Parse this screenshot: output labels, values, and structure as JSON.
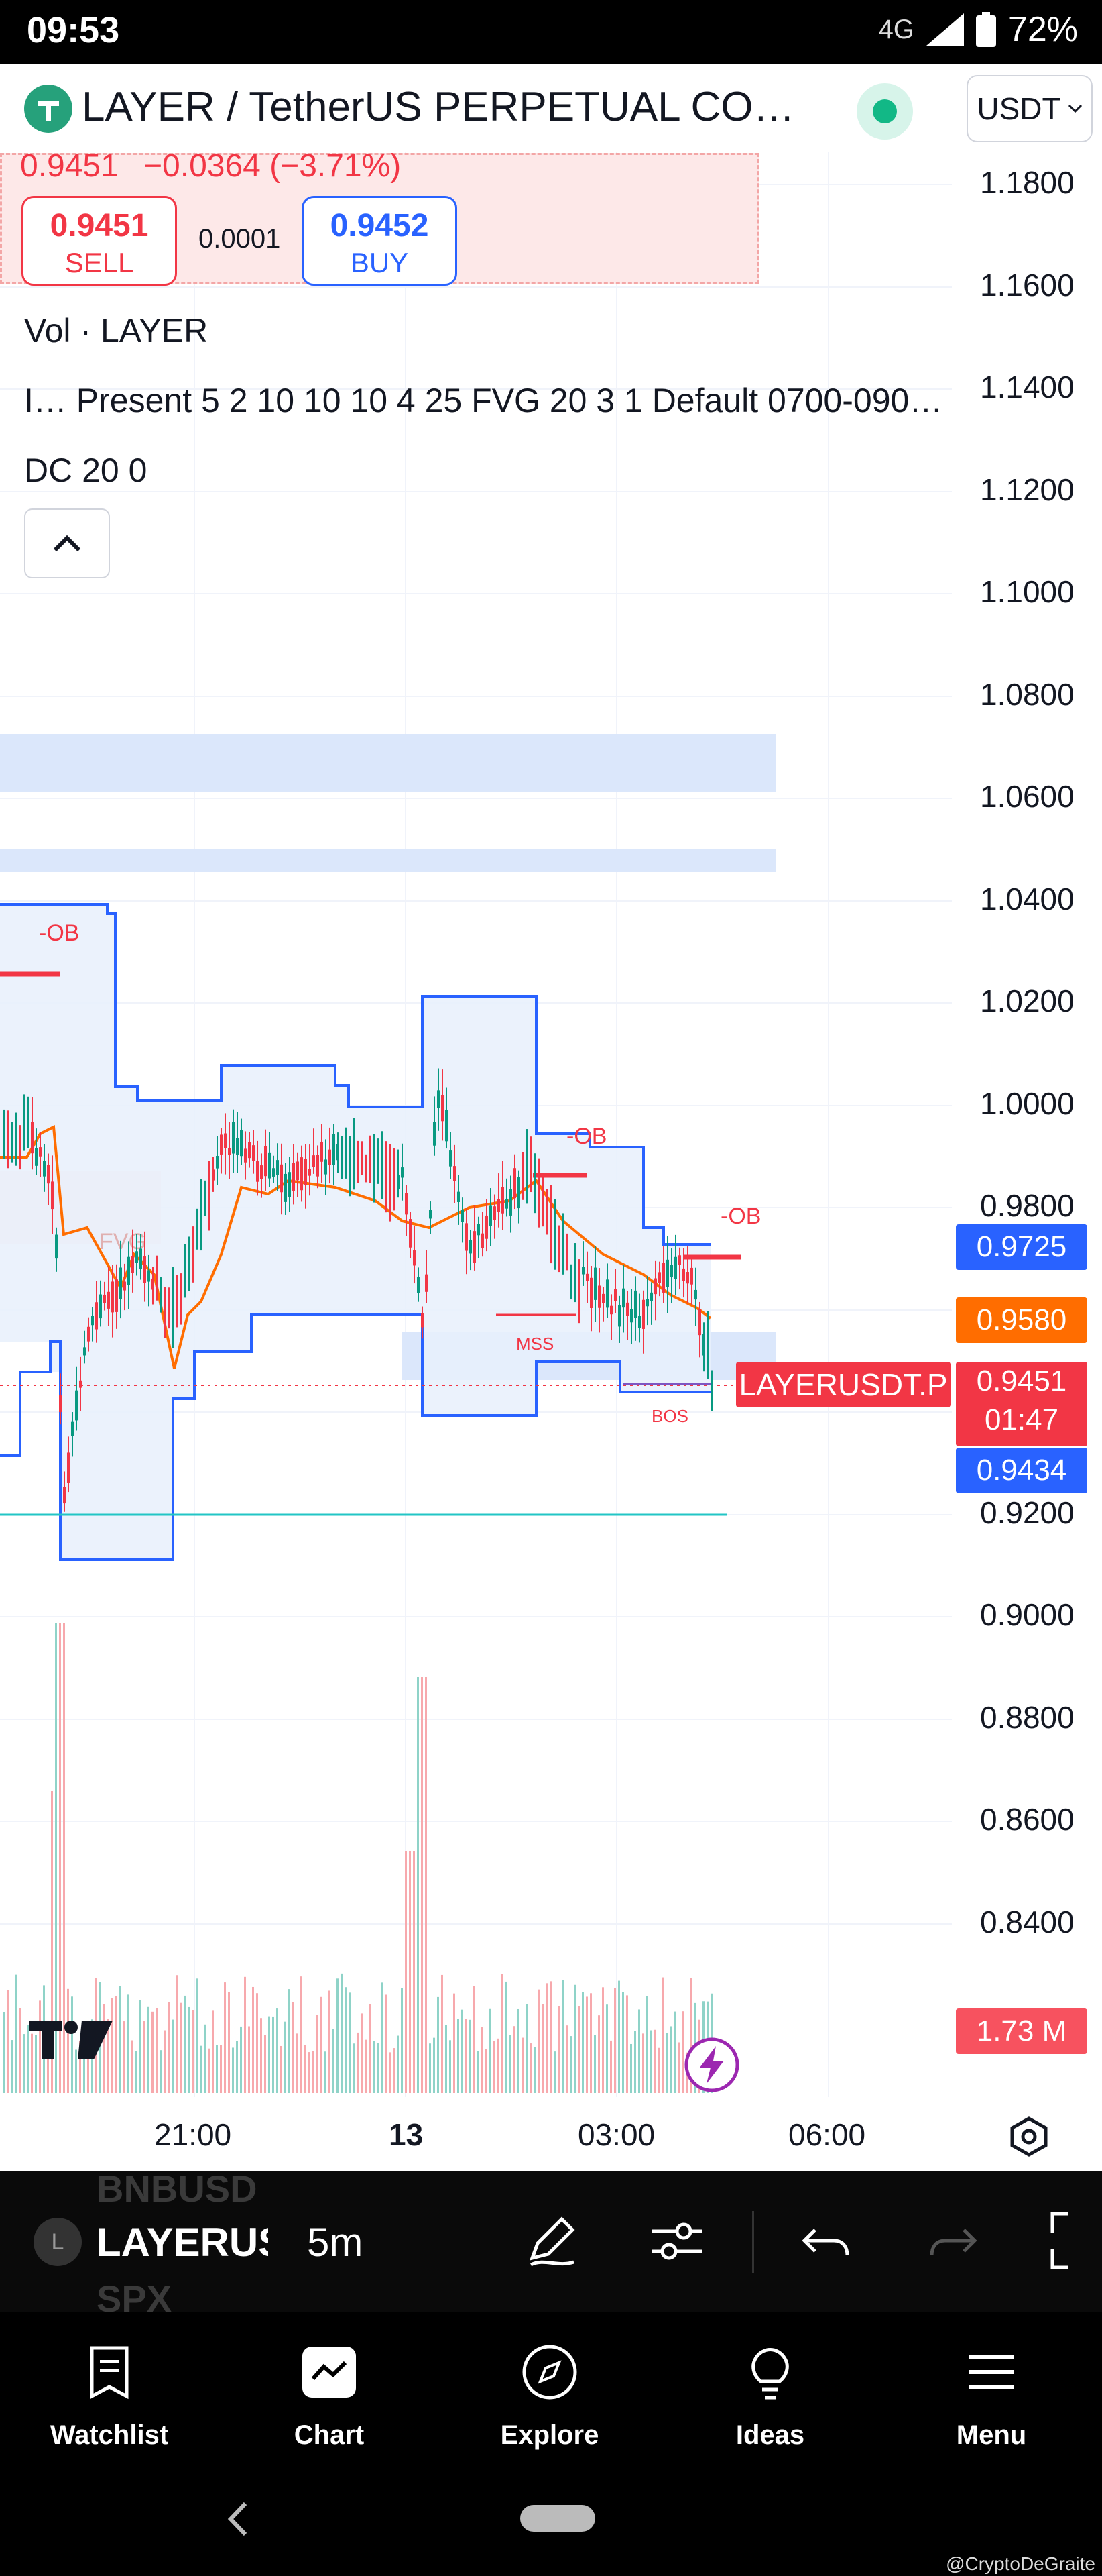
{
  "status_bar": {
    "time": "09:53",
    "network": "4G",
    "battery": "72%"
  },
  "header": {
    "title": "LAYER / TetherUS PERPETUAL CONT…",
    "currency": "USDT"
  },
  "price_panel": {
    "last": "0.9451",
    "change": "−0.0364 (−3.71%)",
    "sell_price": "0.9451",
    "sell_label": "SELL",
    "spread": "0.0001",
    "buy_price": "0.9452",
    "buy_label": "BUY"
  },
  "legends": {
    "volume": "Vol · LAYER",
    "indicator": "I…  Present 5 2 10 10 10 4 25 FVG 20 3 1 Default 0700-090…",
    "donchian": "DC 20 0"
  },
  "price_axis": {
    "labels": [
      "1.1800",
      "1.1600",
      "1.1400",
      "1.1200",
      "1.1000",
      "1.0800",
      "1.0600",
      "1.0400",
      "1.0200",
      "1.0000",
      "0.9800",
      "0.9200",
      "0.9000",
      "0.8800",
      "0.8600",
      "0.8400"
    ],
    "badges": {
      "upper_band": "0.9725",
      "mid_band": "0.9580",
      "last_price": "0.9451",
      "countdown": "01:47",
      "lower_band": "0.9434",
      "volume": "1.73 M"
    },
    "symbol_tag": "LAYERUSDT.P"
  },
  "annotations": {
    "ob": "-OB",
    "fvg": "FVG",
    "mss": "MSS",
    "bos": "BOS"
  },
  "time_axis": {
    "labels": [
      "21:00",
      "13",
      "03:00",
      "06:00"
    ]
  },
  "toolbar": {
    "symbol": "LAYERUS",
    "symbol_initial": "L",
    "ghost_above": "BNBUSD",
    "ghost_below": "SPX",
    "interval": "5m"
  },
  "bottom_nav": {
    "items": [
      {
        "label": "Watchlist",
        "icon": "watchlist-icon"
      },
      {
        "label": "Chart",
        "icon": "chart-icon"
      },
      {
        "label": "Explore",
        "icon": "compass-icon"
      },
      {
        "label": "Ideas",
        "icon": "lightbulb-icon"
      },
      {
        "label": "Menu",
        "icon": "menu-icon"
      }
    ]
  },
  "watermark": "@CryptoDeGraite",
  "colors": {
    "down": "#f23645",
    "up": "#089981",
    "band": "#2962ff",
    "band_fill": "#e3edfb",
    "mid": "#ff6d00",
    "background": "#ffffff"
  }
}
